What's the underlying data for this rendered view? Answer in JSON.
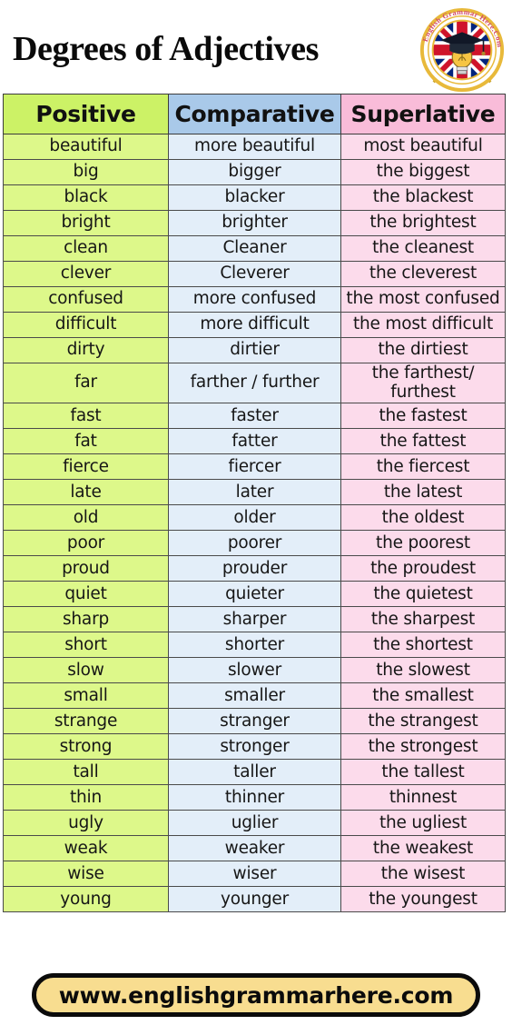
{
  "header": {
    "title": "Degrees of Adjectives",
    "logo": {
      "icon": "english-grammar-here-badge",
      "curved_text": "English Grammar Here.Com",
      "elements": [
        "union-jack-flag",
        "graduation-cap",
        "lightbulb",
        "pencils"
      ]
    }
  },
  "table": {
    "columns": [
      "Positive",
      "Comparative",
      "Superlative"
    ],
    "rows": [
      [
        "beautiful",
        "more beautiful",
        "most beautiful"
      ],
      [
        "big",
        "bigger",
        "the biggest"
      ],
      [
        "black",
        "blacker",
        "the blackest"
      ],
      [
        "bright",
        "brighter",
        "the brightest"
      ],
      [
        "clean",
        "Cleaner",
        "the cleanest"
      ],
      [
        "clever",
        "Cleverer",
        "the cleverest"
      ],
      [
        "confused",
        "more confused",
        "the most confused"
      ],
      [
        "difficult",
        "more difficult",
        "the most difficult"
      ],
      [
        "dirty",
        "dirtier",
        "the dirtiest"
      ],
      [
        "far",
        "farther / further",
        "the farthest/ furthest"
      ],
      [
        "fast",
        "faster",
        "the fastest"
      ],
      [
        "fat",
        "fatter",
        "the fattest"
      ],
      [
        "fierce",
        "fiercer",
        "the fiercest"
      ],
      [
        "late",
        "later",
        "the latest"
      ],
      [
        "old",
        "older",
        "the oldest"
      ],
      [
        "poor",
        "poorer",
        "the poorest"
      ],
      [
        "proud",
        "prouder",
        "the proudest"
      ],
      [
        "quiet",
        "quieter",
        "the quietest"
      ],
      [
        "sharp",
        "sharper",
        "the sharpest"
      ],
      [
        "short",
        "shorter",
        "the shortest"
      ],
      [
        "slow",
        "slower",
        "the slowest"
      ],
      [
        "small",
        "smaller",
        "the smallest"
      ],
      [
        "strange",
        "stranger",
        "the strangest"
      ],
      [
        "strong",
        "stronger",
        "the strongest"
      ],
      [
        "tall",
        "taller",
        "the tallest"
      ],
      [
        "thin",
        "thinner",
        "thinnest"
      ],
      [
        "ugly",
        "uglier",
        "the ugliest"
      ],
      [
        "weak",
        "weaker",
        "the weakest"
      ],
      [
        "wise",
        "wiser",
        "the wisest"
      ],
      [
        "young",
        "younger",
        "the youngest"
      ]
    ],
    "tall_row_indexes": [
      6,
      9
    ],
    "colors": {
      "header_positive": "#ccf266",
      "header_comparative": "#a9c9e9",
      "header_superlative": "#f9bcd9",
      "body_positive": "#ddf88a",
      "body_comparative": "#e3eef9",
      "body_superlative": "#fcdbeb",
      "border": "#4a4a4a"
    }
  },
  "footer": {
    "website": "www.englishgrammarhere.com",
    "colors": {
      "pill_fill": "#f8dd90",
      "pill_border": "#0b0b0b"
    }
  }
}
